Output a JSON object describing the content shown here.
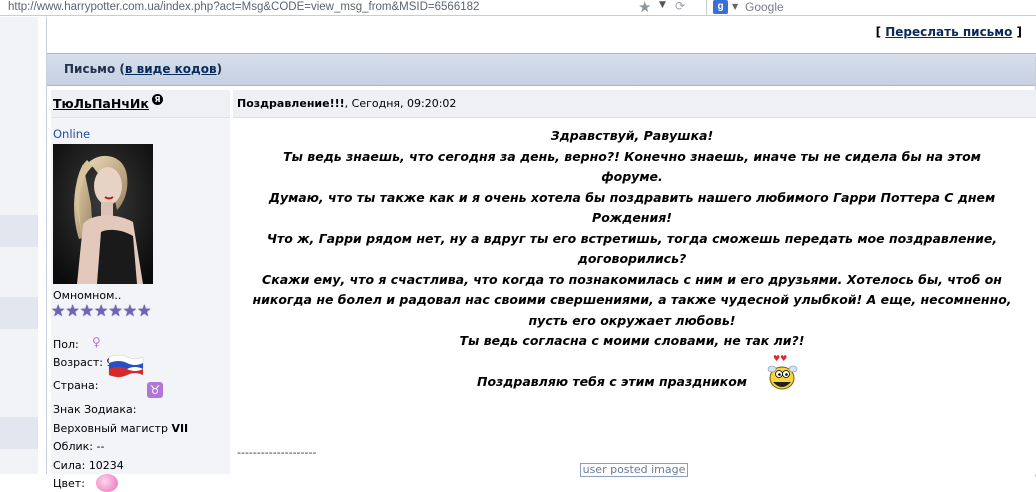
{
  "browser": {
    "url": "http://www.harrypotter.com.ua/index.php?act=Msg&CODE=view_msg_from&MSID=6566182",
    "search_engine": "Google",
    "search_badge": "g"
  },
  "actions": {
    "open": "[",
    "forward_label": "Переслать письмо",
    "close": "]"
  },
  "header": {
    "title": "Письмо (",
    "codes_link": "в виде кодов",
    "title_end": ")"
  },
  "author": {
    "nick": "ТюЛьПаНчИк",
    "badge": "Я",
    "status": "Online",
    "rank": "Омномном..",
    "stars_count": 7,
    "gender_label": "Пол:",
    "age_label": "Возраст:",
    "age_value": "99",
    "country_label": "Страна:",
    "zodiac_label": "Знак Зодиака:",
    "zodiac_sign": "♉",
    "title_text": "Верховный магистр",
    "title_level": "VII",
    "look_label": "Облик:",
    "look_value": "--",
    "power_label": "Сила:",
    "power_value": "10234",
    "color_label": "Цвет:"
  },
  "message": {
    "subject": "Поздравление!!!",
    "date": ", Сегодня, 09:20:02",
    "body_lines": [
      "Здравствуй, Равушка!",
      "Ты ведь знаешь, что сегодня за день, верно?! Конечно знаешь, иначе ты не сидела бы на этом",
      "форуме.",
      "Думаю, что ты также как и я очень хотела бы поздравить нашего любимого Гарри Поттера С днем",
      "Рождения!",
      "Что ж, Гарри рядом нет, ну а вдруг ты его встретишь, тогда сможешь передать мое поздравление,",
      "договорились?",
      "Скажи ему, что я счастлива, что когда то познакомилась с ним и его друзьями. Хотелось бы, чтоб он",
      "никогда не болел и радовал нас своими свершениями, а также чудесной улыбкой! А еще, несомненно,",
      "пусть его окружает любовь!",
      "Ты ведь согласна с моими словами, не так ли?!"
    ],
    "closing": "Поздравляю тебя с этим праздником",
    "signature_divider": "--------------------",
    "user_image_label": "user posted image"
  },
  "colors": {
    "header_bg": "#c5d0e1",
    "link": "#0b2a5c",
    "online": "#1d4fa6"
  }
}
